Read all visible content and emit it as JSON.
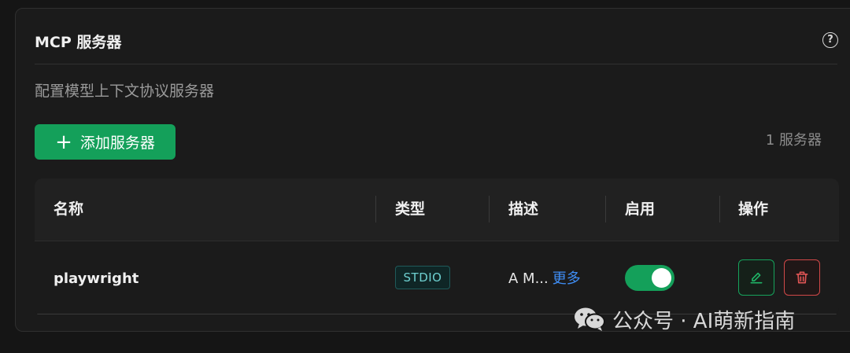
{
  "header": {
    "title": "MCP 服务器",
    "help_icon": "help-circle-icon",
    "subtitle": "配置模型上下文协议服务器"
  },
  "toolbar": {
    "add_label": "添加服务器",
    "count_label": "1 服务器"
  },
  "table": {
    "columns": [
      "名称",
      "类型",
      "描述",
      "启用",
      "操作"
    ],
    "rows": [
      {
        "name": "playwright",
        "type": "STDIO",
        "description": "A M...",
        "more_label": "更多",
        "enabled": true
      }
    ]
  },
  "watermark": {
    "text": "公众号 · AI萌新指南"
  },
  "colors": {
    "accent": "#14a05a",
    "danger": "#d14848",
    "link": "#3f8ef5",
    "tag_text": "#6ed0d0"
  }
}
